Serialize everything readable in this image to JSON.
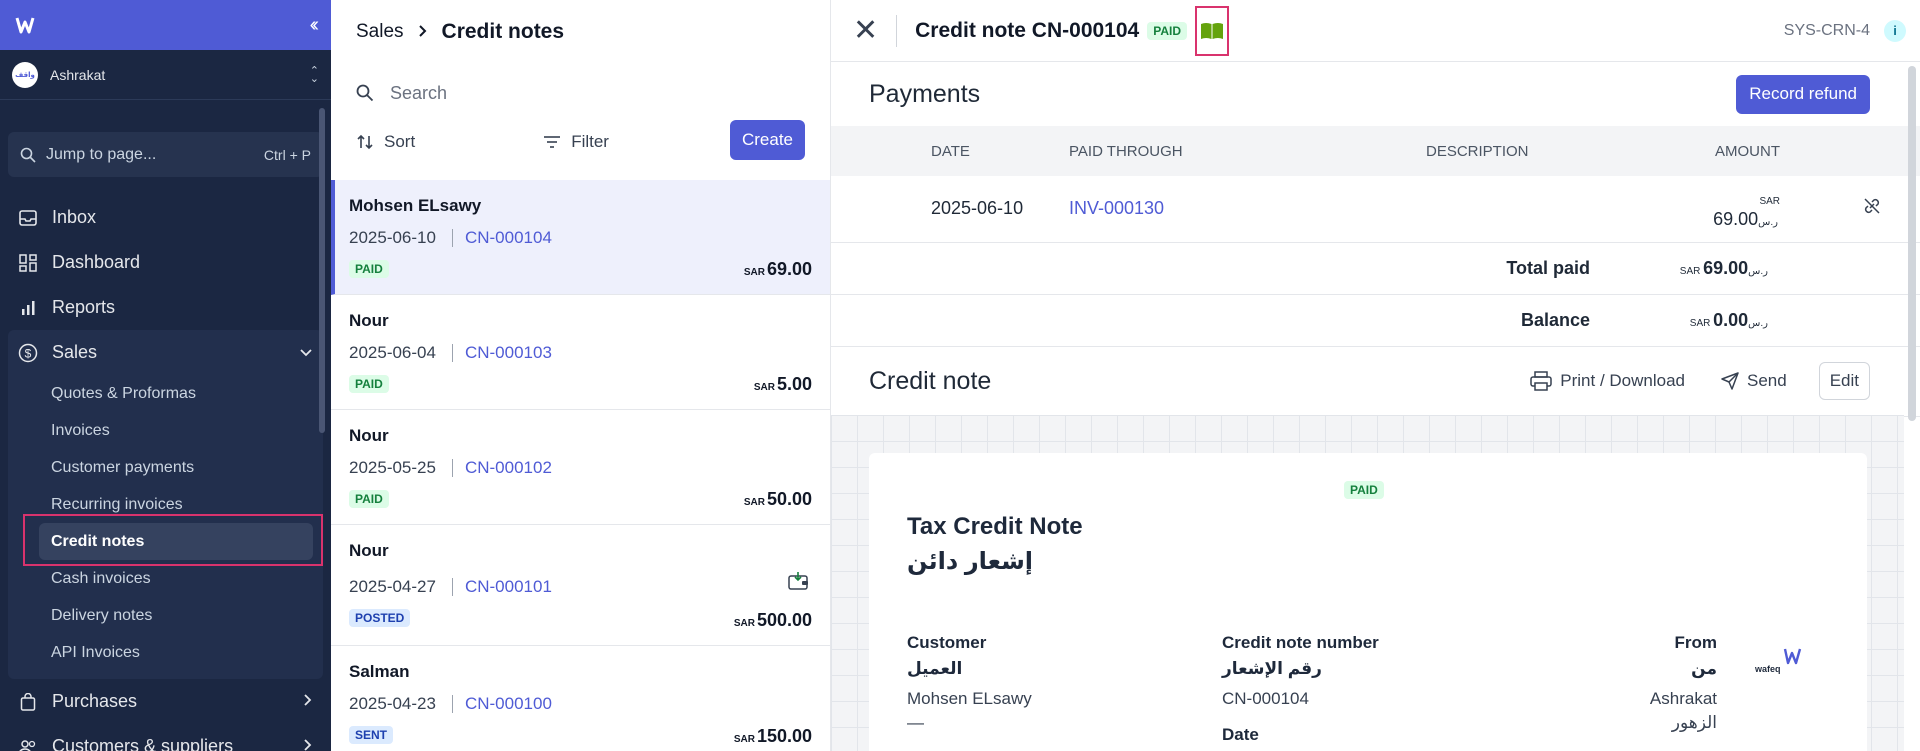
{
  "sidebar": {
    "org_name": "Ashrakat",
    "org_avatar_text": "واقف",
    "jump": {
      "label": "Jump to page...",
      "shortcut": "Ctrl + P"
    },
    "nav": [
      {
        "label": "Inbox",
        "icon": "inbox-icon"
      },
      {
        "label": "Dashboard",
        "icon": "dashboard-icon"
      },
      {
        "label": "Reports",
        "icon": "reports-icon"
      }
    ],
    "sales": {
      "label": "Sales",
      "icon": "dollar-icon",
      "items": [
        "Quotes & Proformas",
        "Invoices",
        "Customer payments",
        "Recurring invoices",
        "Credit notes",
        "Cash invoices",
        "Delivery notes",
        "API Invoices"
      ],
      "active": "Credit notes"
    },
    "after": [
      {
        "label": "Purchases",
        "icon": "bag-icon"
      },
      {
        "label": "Customers & suppliers",
        "icon": "people-icon"
      }
    ]
  },
  "list": {
    "breadcrumb": {
      "parent": "Sales",
      "current": "Credit notes"
    },
    "search_placeholder": "Search",
    "sort_label": "Sort",
    "filter_label": "Filter",
    "create_label": "Create",
    "rows": [
      {
        "name": "Mohsen ELsawy",
        "date": "2025-06-10",
        "number": "CN-000104",
        "status": "PAID",
        "status_class": "paid",
        "currency": "SAR",
        "amount": "69.00",
        "selected": true
      },
      {
        "name": "Nour",
        "date": "2025-06-04",
        "number": "CN-000103",
        "status": "PAID",
        "status_class": "paid",
        "currency": "SAR",
        "amount": "5.00"
      },
      {
        "name": "Nour",
        "date": "2025-05-25",
        "number": "CN-000102",
        "status": "PAID",
        "status_class": "paid",
        "currency": "SAR",
        "amount": "50.00"
      },
      {
        "name": "Nour",
        "date": "2025-04-27",
        "number": "CN-000101",
        "status": "POSTED",
        "status_class": "posted",
        "currency": "SAR",
        "amount": "500.00",
        "icon": "wallet-icon"
      },
      {
        "name": "Salman",
        "date": "2025-04-23",
        "number": "CN-000100",
        "status": "SENT",
        "status_class": "sent",
        "currency": "SAR",
        "amount": "150.00"
      }
    ]
  },
  "detail": {
    "title": "Credit note CN-000104",
    "status": "PAID",
    "sys_id": "SYS-CRN-4",
    "info": "i",
    "payments": {
      "title": "Payments",
      "refund_label": "Record refund",
      "columns": [
        "DATE",
        "PAID THROUGH",
        "DESCRIPTION",
        "AMOUNT"
      ],
      "rows": [
        {
          "date": "2025-06-10",
          "paid_through": "INV-000130",
          "description": "",
          "currency": "SAR ر.س",
          "amount": "69.00"
        }
      ],
      "total_paid_label": "Total paid",
      "total_paid_currency": "SAR ر.س",
      "total_paid": "69.00",
      "balance_label": "Balance",
      "balance_currency": "SAR ر.س",
      "balance": "0.00"
    },
    "credit_note": {
      "title": "Credit note",
      "print_label": "Print / Download",
      "send_label": "Send",
      "edit_label": "Edit"
    },
    "document": {
      "status": "PAID",
      "title_en": "Tax Credit Note",
      "title_ar": "إشعار دائن",
      "customer_label": "Customer",
      "customer_label_ar": "العميل",
      "customer_name": "Mohsen ELsawy",
      "customer_extra": "—",
      "number_label": "Credit note number",
      "number_label_ar": "رقم الإشعار",
      "number_value": "CN-000104",
      "date_label": "Date",
      "from_label": "From",
      "from_label_ar": "من",
      "from_name": "Ashrakat",
      "from_extra": "الزهور",
      "logo_text": "wafeq"
    }
  },
  "colors": {
    "brand": "#4f5bd5",
    "sidebar": "#1b2742",
    "paid": "#15803d",
    "highlight": "#d9336d"
  }
}
